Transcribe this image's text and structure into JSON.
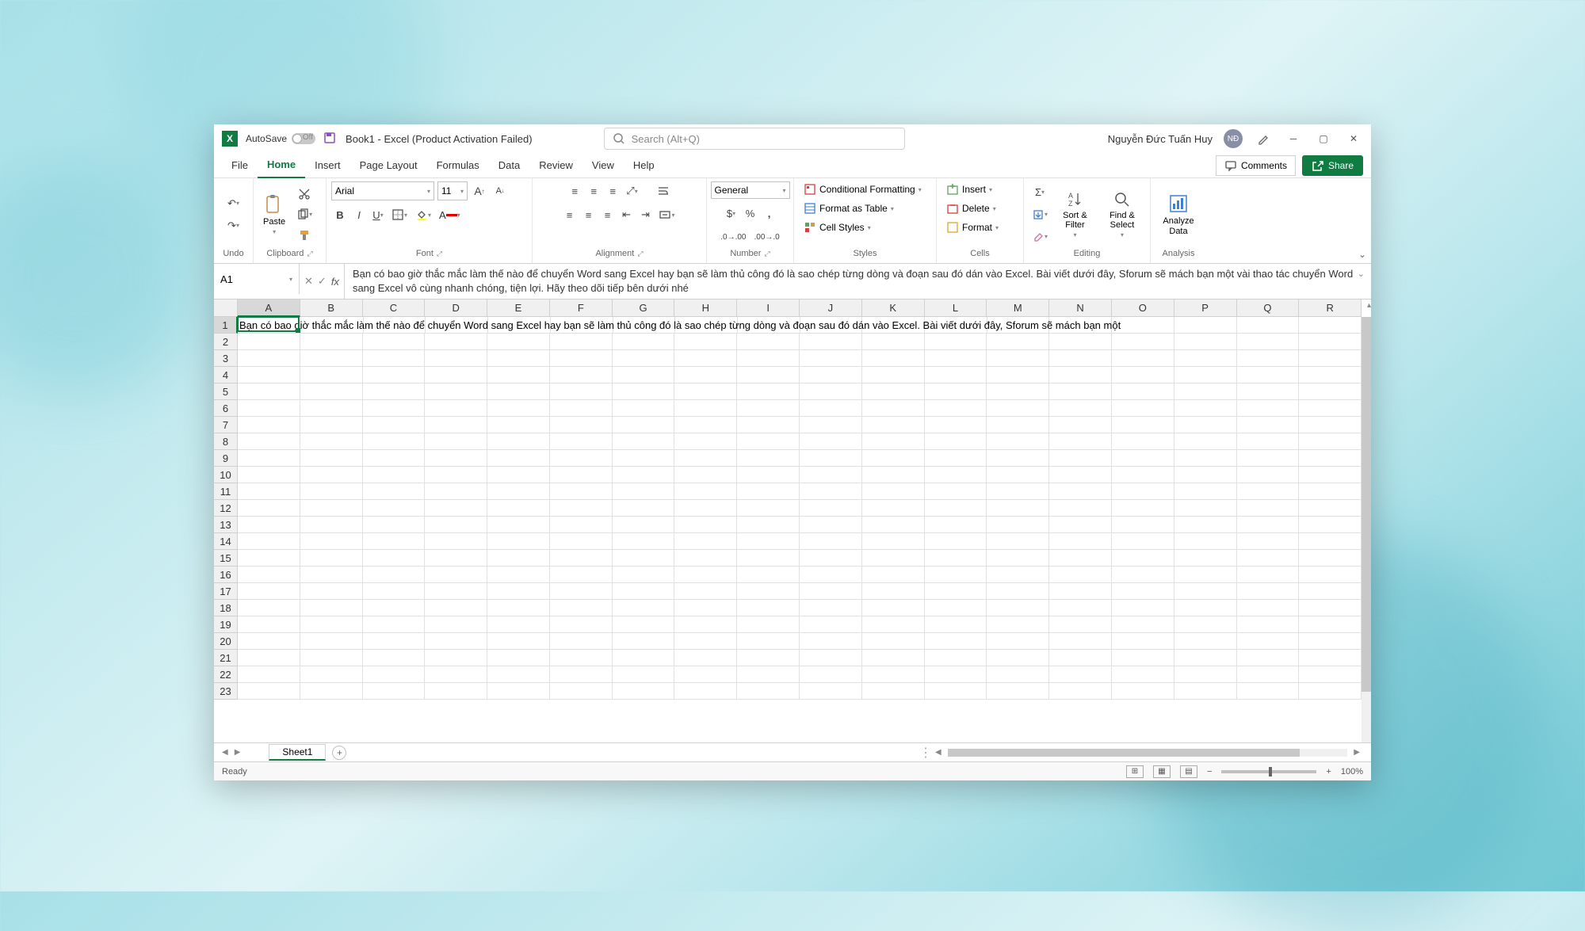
{
  "titlebar": {
    "autosave_label": "AutoSave",
    "autosave_state": "Off",
    "document_title": "Book1 - Excel (Product Activation Failed)",
    "search_placeholder": "Search (Alt+Q)",
    "user_name": "Nguyễn Đức Tuấn Huy",
    "user_initials": "NĐ"
  },
  "menubar": {
    "items": [
      "File",
      "Home",
      "Insert",
      "Page Layout",
      "Formulas",
      "Data",
      "Review",
      "View",
      "Help"
    ],
    "active": "Home",
    "comments": "Comments",
    "share": "Share"
  },
  "ribbon": {
    "undo_label": "Undo",
    "clipboard_label": "Clipboard",
    "paste_label": "Paste",
    "font_label": "Font",
    "font_name": "Arial",
    "font_size": "11",
    "alignment_label": "Alignment",
    "number_label": "Number",
    "number_format": "General",
    "styles_label": "Styles",
    "conditional_formatting": "Conditional Formatting",
    "format_as_table": "Format as Table",
    "cell_styles": "Cell Styles",
    "cells_label": "Cells",
    "insert": "Insert",
    "delete": "Delete",
    "format": "Format",
    "editing_label": "Editing",
    "sort_filter": "Sort & Filter",
    "find_select": "Find & Select",
    "analysis_label": "Analysis",
    "analyze_data": "Analyze Data"
  },
  "formula": {
    "name_box": "A1",
    "content": "Bạn có bao giờ thắc mắc làm thế nào để chuyển Word sang Excel hay bạn sẽ làm thủ công đó là sao chép từng dòng và đoạn sau đó dán vào Excel. Bài viết dưới đây, Sforum sẽ mách bạn một vài thao tác chuyển Word sang Excel vô cùng nhanh chóng, tiện lợi. Hãy theo dõi tiếp bên dưới nhé"
  },
  "grid": {
    "columns": [
      "A",
      "B",
      "C",
      "D",
      "E",
      "F",
      "G",
      "H",
      "I",
      "J",
      "K",
      "L",
      "M",
      "N",
      "O",
      "P",
      "Q",
      "R"
    ],
    "rows": [
      "1",
      "2",
      "3",
      "4",
      "5",
      "6",
      "7",
      "8",
      "9",
      "10",
      "11",
      "12",
      "13",
      "14",
      "15",
      "16",
      "17",
      "18",
      "19",
      "20",
      "21",
      "22",
      "23"
    ],
    "active_cell": "A1",
    "cell_a1_display": "Bạn có bao giờ thắc mắc làm thế nào để chuyển Word sang Excel hay bạn sẽ làm thủ công đó là sao chép từng dòng và đoạn sau đó dán vào Excel. Bài viết dưới đây, Sforum sẽ mách bạn một"
  },
  "sheets": {
    "active": "Sheet1"
  },
  "statusbar": {
    "status": "Ready",
    "zoom": "100%"
  }
}
